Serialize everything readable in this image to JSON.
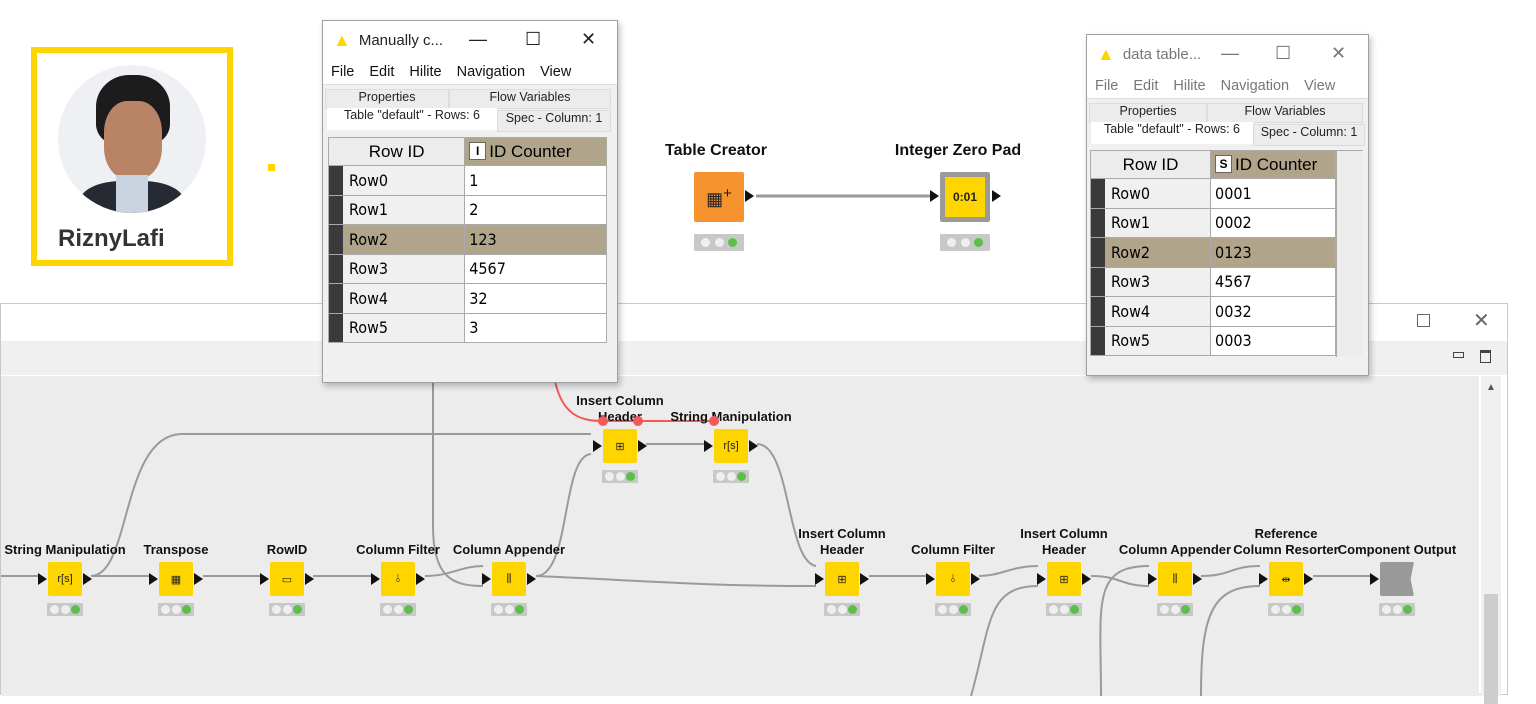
{
  "profile": {
    "name": "RiznyLafi",
    "accent": "#ffd500"
  },
  "table_window_1": {
    "title": "Manually c...",
    "menu": [
      "File",
      "Edit",
      "Hilite",
      "Navigation",
      "View"
    ],
    "tabs": [
      "Properties",
      "Flow Variables",
      "Table \"default\" - Rows: 6",
      "Spec - Column: 1"
    ],
    "headers": [
      "Row ID",
      "ID Counter"
    ],
    "col_type": "I",
    "rows": [
      [
        "Row0",
        "1"
      ],
      [
        "Row1",
        "2"
      ],
      [
        "Row2",
        "123"
      ],
      [
        "Row3",
        "4567"
      ],
      [
        "Row4",
        "32"
      ],
      [
        "Row5",
        "3"
      ]
    ],
    "highlighted_row": 2
  },
  "table_window_2": {
    "title": "data table...",
    "menu": [
      "File",
      "Edit",
      "Hilite",
      "Navigation",
      "View"
    ],
    "tabs": [
      "Properties",
      "Flow Variables",
      "Table \"default\" - Rows: 6",
      "Spec - Column: 1"
    ],
    "headers": [
      "Row ID",
      "ID Counter"
    ],
    "col_type": "S",
    "rows": [
      [
        "Row0",
        "0001"
      ],
      [
        "Row1",
        "0002"
      ],
      [
        "Row2",
        "0123"
      ],
      [
        "Row3",
        "4567"
      ],
      [
        "Row4",
        "0032"
      ],
      [
        "Row5",
        "0003"
      ]
    ],
    "highlighted_row": 2
  },
  "top_nodes": [
    {
      "label": "Table Creator",
      "icon": "table-plus-icon",
      "color": "#f7932e"
    },
    {
      "label": "Integer Zero Pad",
      "icon": "zero-pad-icon",
      "color": "#ffd500"
    }
  ],
  "workflow_nodes": [
    {
      "label": "String Manipulation",
      "icon": "r[s]"
    },
    {
      "label": "Transpose",
      "icon": "transpose-icon"
    },
    {
      "label": "RowID",
      "icon": "rowid-icon"
    },
    {
      "label": "Column Filter",
      "icon": "column-filter-icon"
    },
    {
      "label": "Column Appender",
      "icon": "column-appender-icon"
    },
    {
      "label": "Insert Column Header",
      "icon": "insert-header-icon"
    },
    {
      "label": "String Manipulation",
      "icon": "r[s]"
    },
    {
      "label": "Insert Column Header",
      "icon": "insert-header-icon"
    },
    {
      "label": "Column Filter",
      "icon": "column-filter-icon"
    },
    {
      "label": "Insert Column Header",
      "icon": "insert-header-icon"
    },
    {
      "label": "Column Appender",
      "icon": "column-appender-icon"
    },
    {
      "label": "Reference Column Resorter",
      "icon": "resorter-icon"
    },
    {
      "label": "Component Output",
      "icon": "component-output-icon"
    }
  ],
  "node_status": "executed"
}
